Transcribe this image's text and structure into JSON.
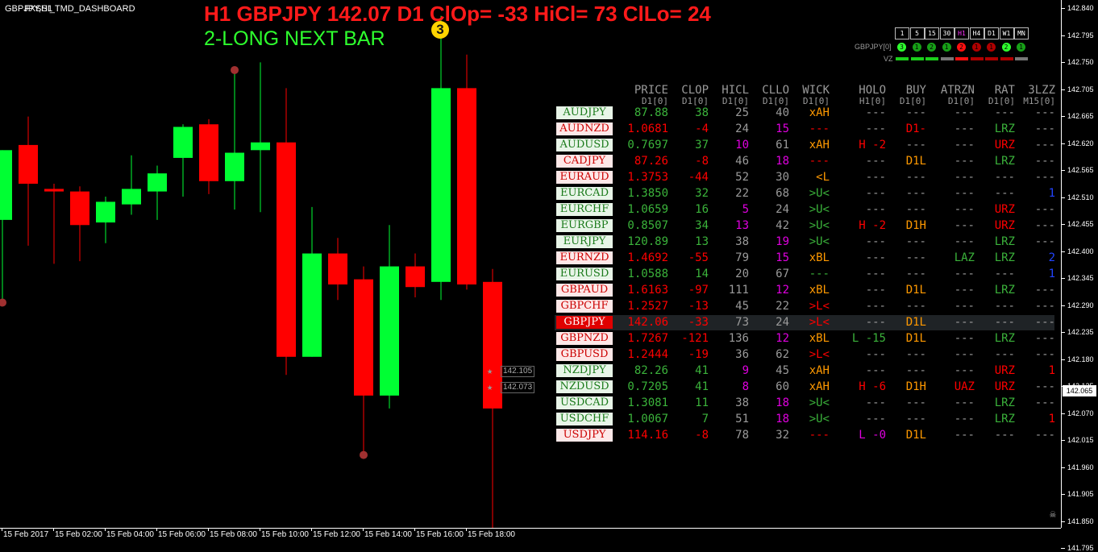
{
  "window": {
    "symbol_label": "GBPJPY,H1",
    "indicator_name": "FXSSI_TMD_DASHBOARD"
  },
  "headline": {
    "title": "H1 GBPJPY 142.07  D1 ClOp= -33 HiCl= 73 ClLo= 24",
    "signal": "2-LONG NEXT BAR"
  },
  "colors": {
    "up": "#00ff33",
    "down": "#ff0000",
    "orange": "#ff9900",
    "magenta": "#e000e0",
    "grey": "#9a9a9a",
    "green_text": "#3bb33b",
    "blue": "#2244ff"
  },
  "timeframes": [
    "1",
    "5",
    "15",
    "30",
    "H1",
    "H4",
    "D1",
    "W1",
    "MN"
  ],
  "mini_panel": {
    "label": "GBPJPY[0]",
    "vz_label": "VZ",
    "dots": [
      {
        "t": "3",
        "c": "#2eff2e"
      },
      {
        "t": "1",
        "c": "#17a017"
      },
      {
        "t": "2",
        "c": "#17a017"
      },
      {
        "t": "1",
        "c": "#17a017"
      },
      {
        "t": "2",
        "c": "#ff1010"
      },
      {
        "t": "1",
        "c": "#b00000"
      },
      {
        "t": "1",
        "c": "#b00000"
      },
      {
        "t": "2",
        "c": "#2eff2e"
      },
      {
        "t": "1",
        "c": "#17a017"
      }
    ],
    "vz_colors": [
      "#1bcf1b",
      "#1bcf1b",
      "#1bcf1b",
      "#777777",
      "#ff1010",
      "#b00000",
      "#b00000",
      "#b00000",
      "#777777"
    ]
  },
  "dashboard": {
    "headers": [
      {
        "label": "PRICE",
        "sub": "D1[0]"
      },
      {
        "label": "CLOP",
        "sub": "D1[0]"
      },
      {
        "label": "HICL",
        "sub": "D1[0]"
      },
      {
        "label": "CLLO",
        "sub": "D1[0]"
      },
      {
        "label": "WICK",
        "sub": "D1[0]"
      },
      {
        "label": "HOLO",
        "sub": "H1[0]"
      },
      {
        "label": "BUY",
        "sub": "D1[0]"
      },
      {
        "label": "ATRZN",
        "sub": "D1[0]"
      },
      {
        "label": "RAT",
        "sub": "D1[0]"
      },
      {
        "label": "3LZZ",
        "sub": "M15[0]"
      }
    ],
    "rows": [
      {
        "pair": "AUDJPY",
        "price": "87.88",
        "clop": "38",
        "hicl": "25",
        "cllo": "40",
        "wick": "xAH",
        "holo": "---",
        "buy": "---",
        "atrzn": "---",
        "rat": "---",
        "lzz": "---",
        "dir": "up"
      },
      {
        "pair": "AUDNZD",
        "price": "1.0681",
        "clop": "-4",
        "hicl": "24",
        "cllo": "15",
        "wick": "---",
        "holo": "---",
        "buy": "D1-",
        "atrzn": "---",
        "rat": "LRZ",
        "lzz": "---",
        "dir": "down"
      },
      {
        "pair": "AUDUSD",
        "price": "0.7697",
        "clop": "37",
        "hicl": "10",
        "cllo": "61",
        "wick": "xAH",
        "holo": "H -2",
        "buy": "---",
        "atrzn": "---",
        "rat": "URZ",
        "lzz": "---",
        "dir": "up"
      },
      {
        "pair": "CADJPY",
        "price": "87.26",
        "clop": "-8",
        "hicl": "46",
        "cllo": "18",
        "wick": "---",
        "holo": "---",
        "buy": "D1L",
        "atrzn": "---",
        "rat": "LRZ",
        "lzz": "---",
        "dir": "down"
      },
      {
        "pair": "EURAUD",
        "price": "1.3753",
        "clop": "-44",
        "hicl": "52",
        "cllo": "30",
        "wick": "<L",
        "holo": "---",
        "buy": "---",
        "atrzn": "---",
        "rat": "---",
        "lzz": "---",
        "dir": "down"
      },
      {
        "pair": "EURCAD",
        "price": "1.3850",
        "clop": "32",
        "hicl": "22",
        "cllo": "68",
        "wick": ">U<",
        "holo": "---",
        "buy": "---",
        "atrzn": "---",
        "rat": "---",
        "lzz": "1",
        "dir": "up"
      },
      {
        "pair": "EURCHF",
        "price": "1.0659",
        "clop": "16",
        "hicl": "5",
        "cllo": "24",
        "wick": ">U<",
        "holo": "---",
        "buy": "---",
        "atrzn": "---",
        "rat": "URZ",
        "lzz": "---",
        "dir": "up"
      },
      {
        "pair": "EURGBP",
        "price": "0.8507",
        "clop": "34",
        "hicl": "13",
        "cllo": "42",
        "wick": ">U<",
        "holo": "H -2",
        "buy": "D1H",
        "atrzn": "---",
        "rat": "URZ",
        "lzz": "---",
        "dir": "up"
      },
      {
        "pair": "EURJPY",
        "price": "120.89",
        "clop": "13",
        "hicl": "38",
        "cllo": "19",
        "wick": ">U<",
        "holo": "---",
        "buy": "---",
        "atrzn": "---",
        "rat": "LRZ",
        "lzz": "---",
        "dir": "up"
      },
      {
        "pair": "EURNZD",
        "price": "1.4692",
        "clop": "-55",
        "hicl": "79",
        "cllo": "15",
        "wick": "xBL",
        "holo": "---",
        "buy": "---",
        "atrzn": "LAZ",
        "rat": "LRZ",
        "lzz": "2",
        "dir": "down"
      },
      {
        "pair": "EURUSD",
        "price": "1.0588",
        "clop": "14",
        "hicl": "20",
        "cllo": "67",
        "wick": "---",
        "holo": "---",
        "buy": "---",
        "atrzn": "---",
        "rat": "---",
        "lzz": "1",
        "dir": "up"
      },
      {
        "pair": "GBPAUD",
        "price": "1.6163",
        "clop": "-97",
        "hicl": "111",
        "cllo": "12",
        "wick": "xBL",
        "holo": "---",
        "buy": "D1L",
        "atrzn": "---",
        "rat": "LRZ",
        "lzz": "---",
        "dir": "down"
      },
      {
        "pair": "GBPCHF",
        "price": "1.2527",
        "clop": "-13",
        "hicl": "45",
        "cllo": "22",
        "wick": ">L<",
        "holo": "---",
        "buy": "---",
        "atrzn": "---",
        "rat": "---",
        "lzz": "---",
        "dir": "down"
      },
      {
        "pair": "GBPJPY",
        "price": "142.06",
        "clop": "-33",
        "hicl": "73",
        "cllo": "24",
        "wick": ">L<",
        "holo": "---",
        "buy": "D1L",
        "atrzn": "---",
        "rat": "---",
        "lzz": "---",
        "dir": "down",
        "selected": true
      },
      {
        "pair": "GBPNZD",
        "price": "1.7267",
        "clop": "-121",
        "hicl": "136",
        "cllo": "12",
        "wick": "xBL",
        "holo": "L -15",
        "buy": "D1L",
        "atrzn": "---",
        "rat": "LRZ",
        "lzz": "---",
        "dir": "down"
      },
      {
        "pair": "GBPUSD",
        "price": "1.2444",
        "clop": "-19",
        "hicl": "36",
        "cllo": "62",
        "wick": ">L<",
        "holo": "---",
        "buy": "---",
        "atrzn": "---",
        "rat": "---",
        "lzz": "---",
        "dir": "down"
      },
      {
        "pair": "NZDJPY",
        "price": "82.26",
        "clop": "41",
        "hicl": "9",
        "cllo": "45",
        "wick": "xAH",
        "holo": "---",
        "buy": "---",
        "atrzn": "---",
        "rat": "URZ",
        "lzz": "1",
        "dir": "up"
      },
      {
        "pair": "NZDUSD",
        "price": "0.7205",
        "clop": "41",
        "hicl": "8",
        "cllo": "60",
        "wick": "xAH",
        "holo": "H -6",
        "buy": "D1H",
        "atrzn": "UAZ",
        "rat": "URZ",
        "lzz": "---",
        "dir": "up"
      },
      {
        "pair": "USDCAD",
        "price": "1.3081",
        "clop": "11",
        "hicl": "38",
        "cllo": "18",
        "wick": ">U<",
        "holo": "---",
        "buy": "---",
        "atrzn": "---",
        "rat": "LRZ",
        "lzz": "---",
        "dir": "up"
      },
      {
        "pair": "USDCHF",
        "price": "1.0067",
        "clop": "7",
        "hicl": "51",
        "cllo": "18",
        "wick": ">U<",
        "holo": "---",
        "buy": "---",
        "atrzn": "---",
        "rat": "LRZ",
        "lzz": "1",
        "dir": "up"
      },
      {
        "pair": "USDJPY",
        "price": "114.16",
        "clop": "-8",
        "hicl": "78",
        "cllo": "32",
        "wick": "---",
        "holo": "L -0",
        "buy": "D1L",
        "atrzn": "---",
        "rat": "---",
        "lzz": "---",
        "dir": "down"
      }
    ]
  },
  "price_axis": {
    "labels": [
      "142.840",
      "142.795",
      "142.750",
      "142.705",
      "142.665",
      "142.620",
      "142.565",
      "142.510",
      "142.455",
      "142.400",
      "142.345",
      "142.290",
      "142.235",
      "142.180",
      "142.125",
      "142.070",
      "142.015",
      "141.960",
      "141.905",
      "141.850",
      "141.795"
    ],
    "current": "142.065"
  },
  "time_axis": [
    "15 Feb 2017",
    "15 Feb 02:00",
    "15 Feb 04:00",
    "15 Feb 06:00",
    "15 Feb 08:00",
    "15 Feb 10:00",
    "15 Feb 12:00",
    "15 Feb 14:00",
    "15 Feb 16:00",
    "15 Feb 18:00"
  ],
  "levels": [
    "142.105",
    "142.073"
  ],
  "badge": "3",
  "candles": [
    {
      "o": 142.43,
      "c": 142.565,
      "h": 142.565,
      "l": 142.27
    },
    {
      "o": 142.575,
      "c": 142.5,
      "h": 142.63,
      "l": 142.38
    },
    {
      "o": 142.49,
      "c": 142.485,
      "h": 142.5,
      "l": 142.345
    },
    {
      "o": 142.485,
      "c": 142.42,
      "h": 142.495,
      "l": 142.35
    },
    {
      "o": 142.425,
      "c": 142.465,
      "h": 142.475,
      "l": 142.385
    },
    {
      "o": 142.46,
      "c": 142.49,
      "h": 142.555,
      "l": 142.44
    },
    {
      "o": 142.485,
      "c": 142.52,
      "h": 142.535,
      "l": 142.43
    },
    {
      "o": 142.55,
      "c": 142.61,
      "h": 142.615,
      "l": 142.475
    },
    {
      "o": 142.615,
      "c": 142.505,
      "h": 142.625,
      "l": 142.48
    },
    {
      "o": 142.505,
      "c": 142.56,
      "h": 142.72,
      "l": 142.45
    },
    {
      "o": 142.565,
      "c": 142.58,
      "h": 142.735,
      "l": 142.445
    },
    {
      "o": 142.58,
      "c": 142.165,
      "h": 142.685,
      "l": 142.13
    },
    {
      "o": 142.165,
      "c": 142.365,
      "h": 142.455,
      "l": 142.165
    },
    {
      "o": 142.365,
      "c": 142.305,
      "h": 142.395,
      "l": 142.275
    },
    {
      "o": 142.315,
      "c": 142.09,
      "h": 142.34,
      "l": 141.975
    },
    {
      "o": 142.09,
      "c": 142.34,
      "h": 142.42,
      "l": 142.065
    },
    {
      "o": 142.34,
      "c": 142.3,
      "h": 142.365,
      "l": 142.28
    },
    {
      "o": 142.31,
      "c": 142.685,
      "h": 142.825,
      "l": 142.275
    },
    {
      "o": 142.685,
      "c": 142.305,
      "h": 142.75,
      "l": 142.295
    },
    {
      "o": 142.31,
      "c": 142.065,
      "h": 142.335,
      "l": 141.79
    }
  ]
}
